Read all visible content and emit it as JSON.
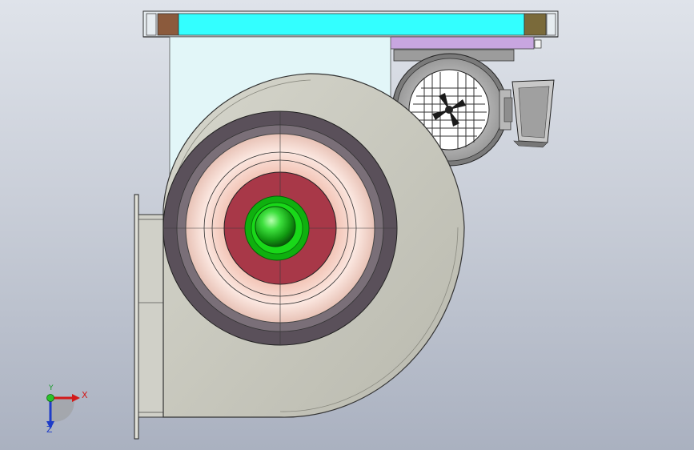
{
  "viewport": {
    "background_top": "#dfe3ea",
    "background_bottom": "#aab1c0"
  },
  "colors": {
    "mounting_rail": "#33ffff",
    "rail_pad": "#8b5a3c",
    "rail_pad_right": "#7a6a3a",
    "motor_bracket": "#c8a6e0",
    "support_plate": "#e2f6f8",
    "housing": "#c9c9bf",
    "outlet_flange": "#d0d0c8",
    "inlet_ring_outer": "#5a505a",
    "inlet_cone": "#f6d6cc",
    "hub_disc": "#a83848",
    "hub_cap": "#22cc22",
    "motor_body": "#d0d0d0",
    "terminal_box": "#c8c8c8"
  },
  "triad": {
    "x_label": "X",
    "y_label": "Y",
    "z_label": "Z",
    "x_color": "#d21a1a",
    "y_color": "#1a9a2a",
    "z_color": "#1e3cc8"
  }
}
